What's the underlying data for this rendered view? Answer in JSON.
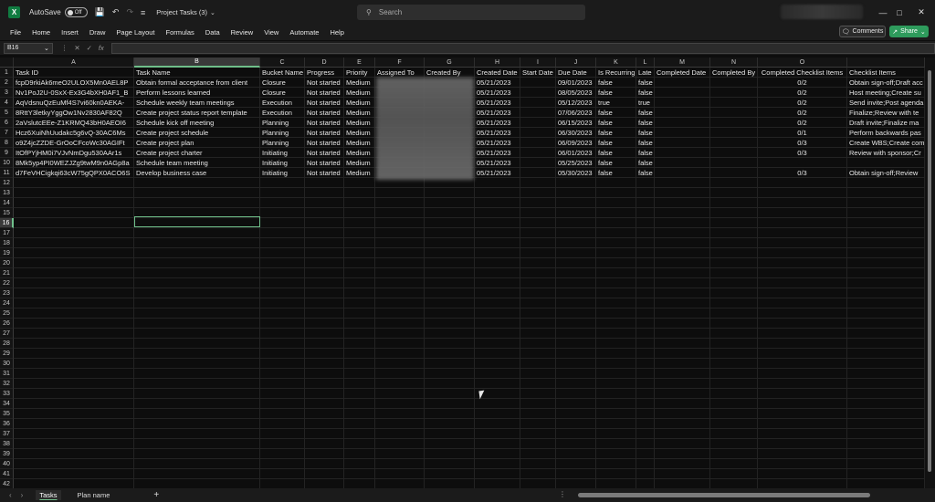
{
  "titlebar": {
    "autosave_label": "AutoSave",
    "autosave_state": "Off",
    "file_title": "Project Tasks (3)",
    "search_placeholder": "Search"
  },
  "menu": [
    "File",
    "Home",
    "Insert",
    "Draw",
    "Page Layout",
    "Formulas",
    "Data",
    "Review",
    "View",
    "Automate",
    "Help"
  ],
  "actions": {
    "comments": "Comments",
    "share": "Share"
  },
  "formula_bar": {
    "name_box": "B16",
    "fx": "fx"
  },
  "columns": [
    "A",
    "B",
    "C",
    "D",
    "E",
    "F",
    "G",
    "H",
    "I",
    "J",
    "K",
    "L",
    "M",
    "N",
    "O",
    ""
  ],
  "headers": [
    "Task ID",
    "Task Name",
    "Bucket Name",
    "Progress",
    "Priority",
    "Assigned To",
    "Created By",
    "Created Date",
    "Start Date",
    "Due Date",
    "Is Recurring",
    "Late",
    "Completed Date",
    "Completed By",
    "Completed Checklist Items",
    "Checklist Items"
  ],
  "rows": [
    [
      "fcpD9rkiAk6meO2ULOX5Mn0AEL8P",
      "Obtain formal acceptance from client",
      "Closure",
      "Not started",
      "Medium",
      "",
      "",
      "05/21/2023",
      "",
      "09/01/2023",
      "false",
      "false",
      "",
      "",
      "0/2",
      "Obtain sign-off;Draft acc"
    ],
    [
      "Nv1PoJ2U-0SxX-Ex3G4bXH0AF1_B",
      "Perform lessons learned",
      "Closure",
      "Not started",
      "Medium",
      "",
      "",
      "05/21/2023",
      "",
      "08/05/2023",
      "false",
      "false",
      "",
      "",
      "0/2",
      "Host meeting;Create su"
    ],
    [
      "AqVdsnuQzEuMf4S7vi60kn0AEKA-",
      "Schedule weekly team meetings",
      "Execution",
      "Not started",
      "Medium",
      "",
      "",
      "05/21/2023",
      "",
      "05/12/2023",
      "true",
      "true",
      "",
      "",
      "0/2",
      "Send invite;Post agenda"
    ],
    [
      "8RttY3letkyYggOw1Nv2830AF82Q",
      "Create project status report template",
      "Execution",
      "Not started",
      "Medium",
      "",
      "",
      "05/21/2023",
      "",
      "07/06/2023",
      "false",
      "false",
      "",
      "",
      "0/2",
      "Finalize;Review with te"
    ],
    [
      "2aVslutcEEe-Z1KRMQ43bH0AEOI6",
      "Schedule kick off meeting",
      "Planning",
      "Not started",
      "Medium",
      "",
      "",
      "05/21/2023",
      "",
      "06/15/2023",
      "false",
      "false",
      "",
      "",
      "0/2",
      "Draft invite;Finalize ma"
    ],
    [
      "Hcz6XuiNhUudakc5g6vQ-30AC6Ms",
      "Create project schedule",
      "Planning",
      "Not started",
      "Medium",
      "",
      "",
      "05/21/2023",
      "",
      "06/30/2023",
      "false",
      "false",
      "",
      "",
      "0/1",
      "Perform backwards pas"
    ],
    [
      "o9Z4jcZZDE-GrOoCFcoWc30AGIFt",
      "Create project plan",
      "Planning",
      "Not started",
      "Medium",
      "",
      "",
      "05/21/2023",
      "",
      "06/09/2023",
      "false",
      "false",
      "",
      "",
      "0/3",
      "Create WBS;Create com"
    ],
    [
      "ItOfPYjHM0i7VJvNmDgu530AAr1s",
      "Create project charter",
      "Initiating",
      "Not started",
      "Medium",
      "",
      "",
      "05/21/2023",
      "",
      "06/01/2023",
      "false",
      "false",
      "",
      "",
      "0/3",
      "Review with sponsor;Cr"
    ],
    [
      "8Mk5yp4PI0WEZJZg9twM9n0AGp8a",
      "Schedule team meeting",
      "Initiating",
      "Not started",
      "Medium",
      "",
      "",
      "05/21/2023",
      "",
      "05/25/2023",
      "false",
      "false",
      "",
      "",
      "",
      ""
    ],
    [
      "d7FeVHCigkqi63cW75gQPX0ACO6S",
      "Develop business case",
      "Initiating",
      "Not started",
      "Medium",
      "",
      "",
      "05/21/2023",
      "",
      "05/30/2023",
      "false",
      "false",
      "",
      "",
      "0/3",
      "Obtain sign-off;Review"
    ]
  ],
  "row_count": 44,
  "sheets": {
    "tabs": [
      "Tasks",
      "Plan name"
    ],
    "active": "Tasks",
    "add": "+"
  }
}
